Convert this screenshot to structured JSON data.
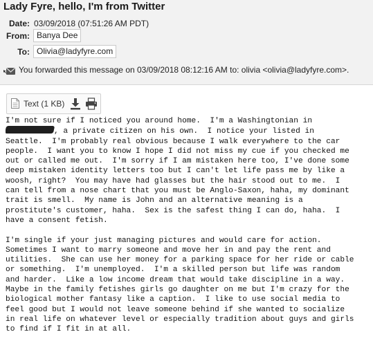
{
  "email": {
    "subject": "Lady Fyre, hello, I'm from Twitter",
    "date_label": "Date:",
    "date_value": "03/09/2018 (07:51:26 AM PDT)",
    "from_label": "From:",
    "from_value": "Banya Dee",
    "to_label": "To:",
    "to_value": "Olivia@ladyfyre.com",
    "forward_notice": "You forwarded this message on 03/09/2018 08:12:16 AM to: olivia <olivia@ladyfyre.com>."
  },
  "attachment": {
    "label": "Text (1 KB)",
    "download_icon": "download-icon",
    "print_icon": "print-icon"
  },
  "body": {
    "line1": "I'm not sure if I noticed you around home.  I'm a Washingtonian in",
    "line2_after_redaction": ", a private citizen on his own.  I notice your listed in",
    "paragraph1_rest": "Seattle.  I'm probably real obvious because I walk everywhere to the car\npeople.  I want you to know I hope I did not miss my cue if you checked me\nout or called me out.  I'm sorry if I am mistaken here too, I've done some\ndeep mistaken identity letters too but I can't let life pass me by like a\nwoosh, right?  You may have had glasses but the hair stood out to me.  I\ncan tell from a nose chart that you must be Anglo-Saxon, haha, my dominant\ntrait is smell.  My name is John and an alternative meaning is a\nprostitute's customer, haha.  Sex is the safest thing I can do, haha.  I\nhave a consent fetish.",
    "paragraph2": "I'm single if your just managing pictures and would care for action.\nSometimes I want to marry someone and move her in and pay the rent and\nutilities.  She can use her money for a parking space for her ride or cable\nor something.  I'm unemployed.  I'm a skilled person but life was random\nand harder.  Like a low income dream that would take discipline in a way.\nMaybe in the family fetishes girls go daughter on me but I'm crazy for the\nbiological mother fantasy like a caption.  I like to use social media to\nfeel good but I would not leave someone behind if she wanted to socialize\nin real life on whatever level or especially tradition about guys and girls\nto find if I fit in at all."
  }
}
